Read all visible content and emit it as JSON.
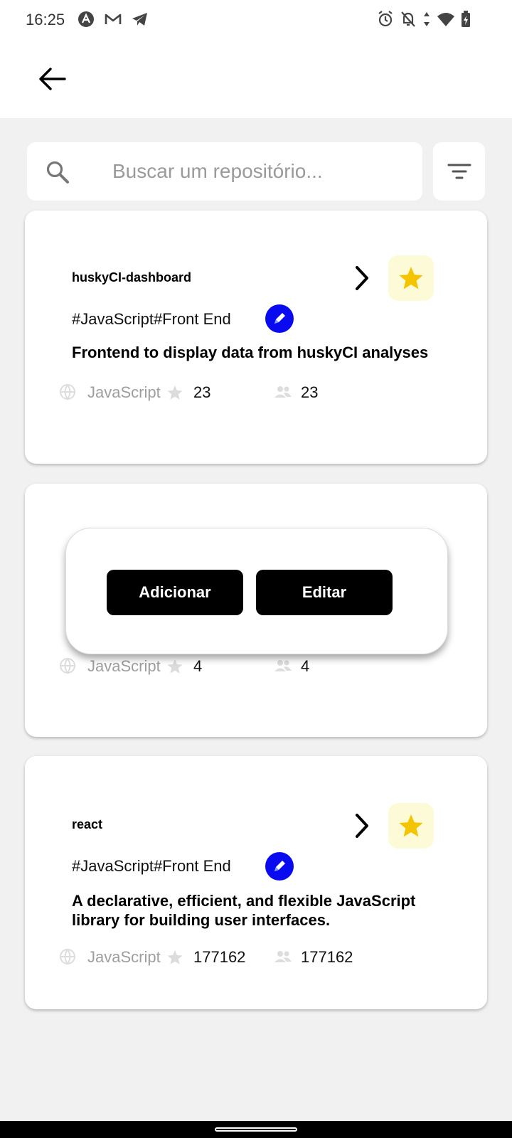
{
  "status_bar": {
    "time": "16:25"
  },
  "search": {
    "placeholder": "Buscar um repositório...",
    "value": ""
  },
  "repos": [
    {
      "name": "huskyCI-dashboard",
      "tags": "#JavaScript#Front End",
      "description": "Frontend to display data from huskyCI analyses",
      "language": "JavaScript",
      "stars": "23",
      "forks": "23"
    },
    {
      "name": "",
      "tags": "",
      "description": "",
      "language": "JavaScript",
      "stars": "4",
      "forks": "4"
    },
    {
      "name": "react",
      "tags": "#JavaScript#Front End",
      "description": "A declarative, efficient, and flexible JavaScript library for building user interfaces.",
      "language": "JavaScript",
      "stars": "177162",
      "forks": "177162"
    }
  ],
  "popup": {
    "add_label": "Adicionar",
    "edit_label": "Editar"
  },
  "colors": {
    "favorite_star": "#f5c400",
    "favorite_bg": "#fdfbd7",
    "edit_badge": "#0a0af0",
    "background": "#f1f1f1"
  }
}
